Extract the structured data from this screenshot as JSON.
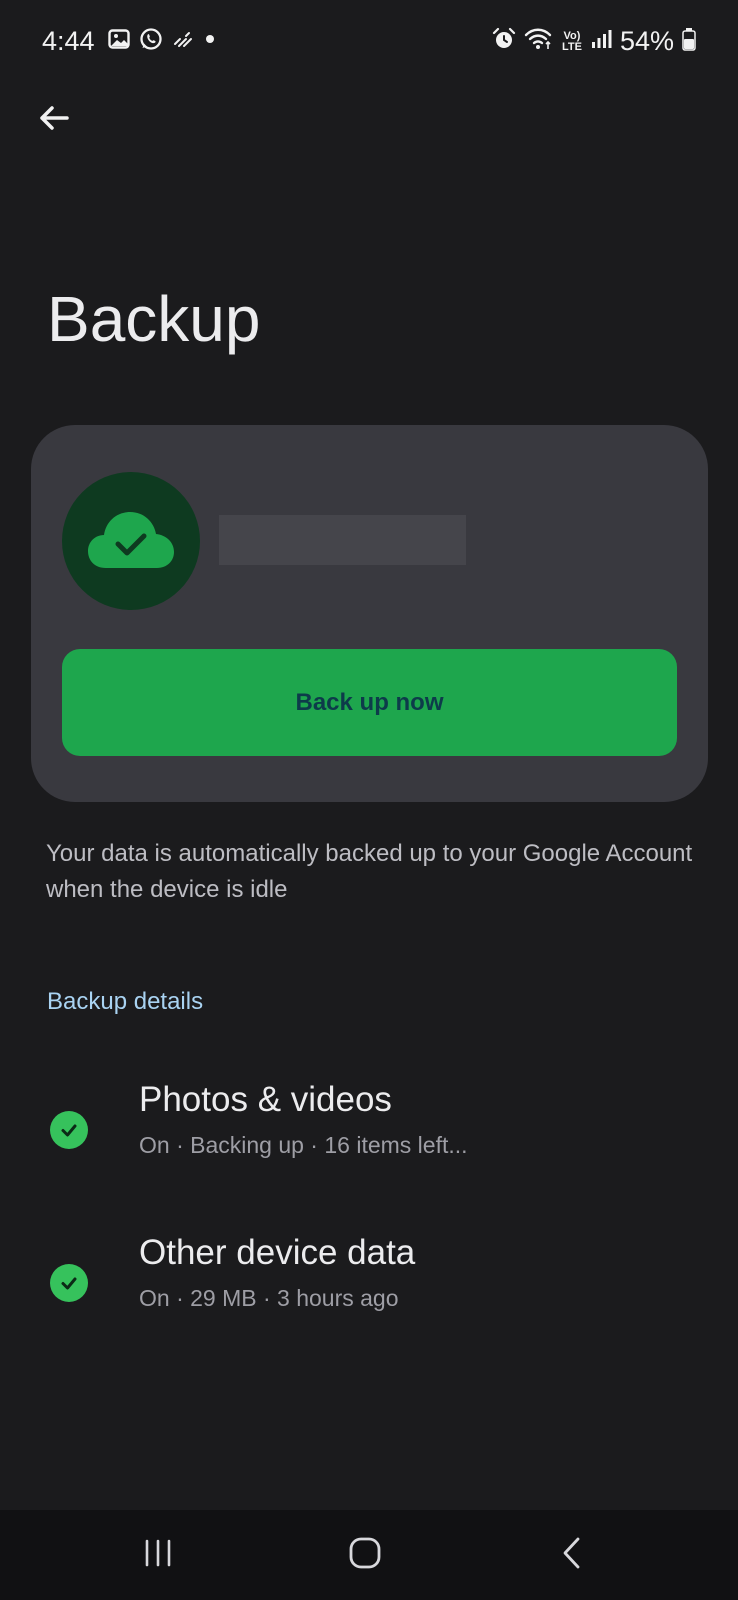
{
  "status_bar": {
    "time": "4:44",
    "battery": "54%",
    "network_label_top": "Vo)",
    "network_label_bottom": "LTE",
    "left_icons": [
      "gallery-icon",
      "whatsapp-icon",
      "data-saver-icon",
      "dot-icon"
    ],
    "right_icons": [
      "alarm-icon",
      "wifi-icon",
      "lte-icon",
      "signal-icon",
      "battery-icon"
    ]
  },
  "header": {
    "back_icon": "back-arrow-icon",
    "title": "Backup"
  },
  "card": {
    "avatar_icon": "cloud-check-icon",
    "account_name": "",
    "backup_now_label": "Back up now"
  },
  "description": "Your data is automatically backed up to your Google Account when the device is idle",
  "details": {
    "header": "Backup details",
    "items": [
      {
        "title": "Photos & videos",
        "subtitle": "On · Backing up · 16 items left...",
        "icon": "check-circle-icon"
      },
      {
        "title": "Other device data",
        "subtitle": "On · 29 MB · 3 hours ago",
        "icon": "check-circle-icon"
      }
    ]
  },
  "nav_bar": {
    "icons": [
      "recents-icon",
      "home-icon",
      "back-icon"
    ]
  },
  "colors": {
    "background": "#1b1b1d",
    "card": "#39393f",
    "accent_green": "#1ea64d",
    "button_text": "#0d3b4a",
    "section_header": "#a9d3f2",
    "check_green": "#36c25c"
  }
}
